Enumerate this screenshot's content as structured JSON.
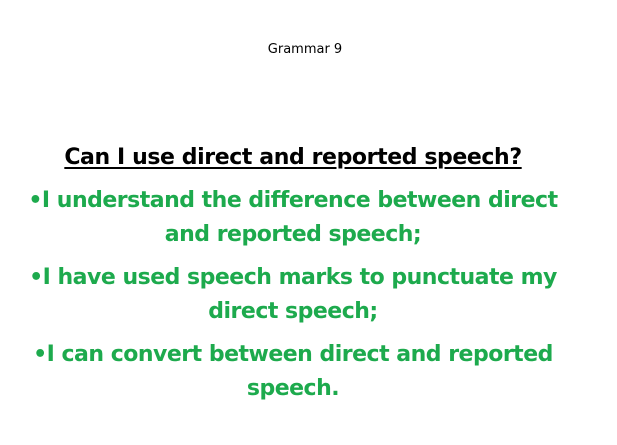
{
  "slide": {
    "header": "Grammar 9",
    "question": "Can I use direct and reported speech?",
    "criteria": [
      "•I understand the difference between direct and reported speech;",
      "•I have used speech marks to punctuate my direct speech;",
      "•I can convert between direct and reported speech."
    ]
  },
  "colors": {
    "criteria_text": "#1daa4d",
    "question_text": "#000000",
    "background": "#ffffff"
  }
}
